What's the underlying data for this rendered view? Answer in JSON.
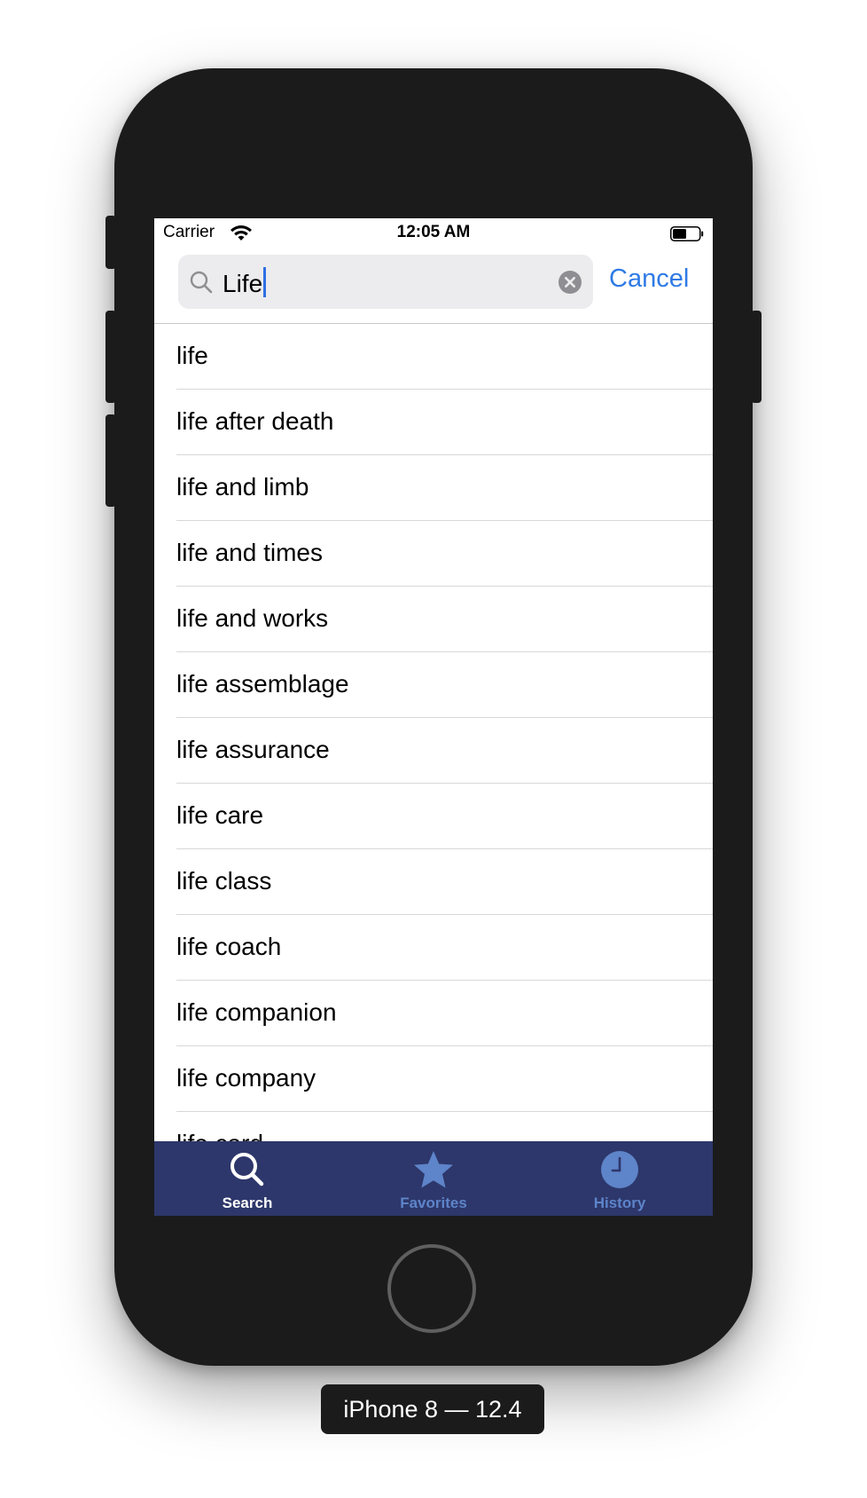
{
  "status_bar": {
    "carrier": "Carrier",
    "time": "12:05 AM",
    "icons": [
      "wifi-icon",
      "battery-icon"
    ]
  },
  "search": {
    "value": "Life",
    "cancel_label": "Cancel",
    "icons": [
      "search-icon",
      "clear-icon"
    ]
  },
  "results": [
    "life",
    "life after death",
    "life and limb",
    "life and times",
    "life and works",
    "life assemblage",
    "life assurance",
    "life care",
    "life class",
    "life coach",
    "life companion",
    "life company",
    "life card"
  ],
  "tab_bar": {
    "background": "#2d376b",
    "active_color": "#ffffff",
    "inactive_color": "#5e84c9",
    "tabs": [
      {
        "label": "Search",
        "icon": "search-icon",
        "active": true
      },
      {
        "label": "Favorites",
        "icon": "star-icon",
        "active": false
      },
      {
        "label": "History",
        "icon": "clock-icon",
        "active": false
      }
    ]
  },
  "device": {
    "caption": "iPhone 8 — 12.4"
  },
  "colors": {
    "accent": "#2f7ae5",
    "frame": "#1b1b1b"
  }
}
